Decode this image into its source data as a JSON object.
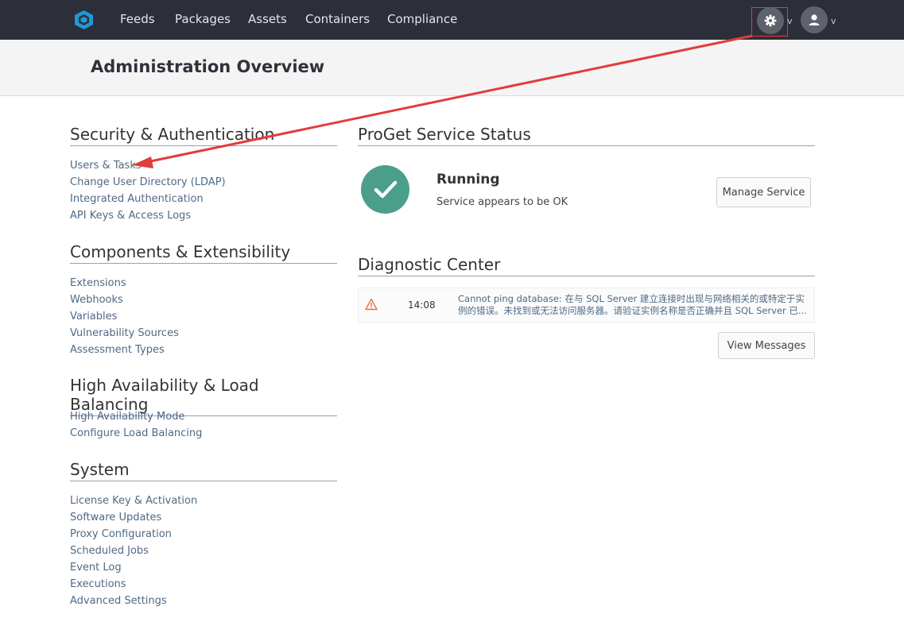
{
  "nav": {
    "items": [
      "Feeds",
      "Packages",
      "Assets",
      "Containers",
      "Compliance"
    ],
    "caret": "v"
  },
  "header": {
    "title": "Administration Overview"
  },
  "sections": [
    {
      "title": "Security & Authentication",
      "links": [
        "Users & Tasks",
        "Change User Directory (LDAP)",
        "Integrated Authentication",
        "API Keys & Access Logs"
      ]
    },
    {
      "title": "Components & Extensibility",
      "links": [
        "Extensions",
        "Webhooks",
        "Variables",
        "Vulnerability Sources",
        "Assessment Types"
      ]
    },
    {
      "title": "High Availability & Load Balancing",
      "links": [
        "High Availability Mode",
        "Configure Load Balancing"
      ]
    },
    {
      "title": "System",
      "links": [
        "License Key & Activation",
        "Software Updates",
        "Proxy Configuration",
        "Scheduled Jobs",
        "Event Log",
        "Executions",
        "Advanced Settings"
      ]
    }
  ],
  "service_status": {
    "title": "ProGet Service Status",
    "state": "Running",
    "description": "Service appears to be OK",
    "manage_label": "Manage Service"
  },
  "diagnostic": {
    "title": "Diagnostic Center",
    "messages": [
      {
        "time": "14:08",
        "text": "Cannot ping database: 在与 SQL Server 建立连接时出现与网络相关的或特定于实例的错误。未找到或无法访问服务器。请验证实例名称是否正确并且 SQL Server 已..."
      }
    ],
    "view_label": "View Messages"
  },
  "colors": {
    "nav_bg": "#2c2f3a",
    "link": "#4e6a86",
    "status_ok": "#4b9e8a",
    "annotation": "#e23c3c",
    "logo": "#1e9ad6"
  },
  "icons": [
    "logo-icon",
    "gear-icon",
    "user-icon",
    "check-icon",
    "warning-icon"
  ]
}
